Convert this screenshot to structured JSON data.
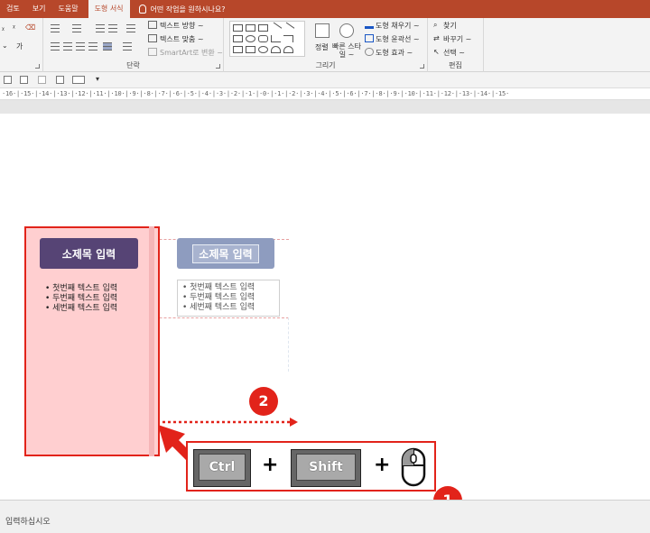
{
  "tabs": [
    "검토",
    "보기",
    "도움말",
    "도형 서식"
  ],
  "active_tab": "도형 서식",
  "tell_me": "어떤 작업을 원하시나요?",
  "ribbon": {
    "paragraph": {
      "label": "단락",
      "text_direction": "텍스트 방향 ~",
      "align_text": "텍스트 맞춤 ~",
      "smartart": "SmartArt로 변환 ~"
    },
    "drawing": {
      "label": "그리기",
      "arrange": "정렬",
      "quick_styles": "빠른 스타일 ~",
      "shape_fill": "도형 채우기 ~",
      "shape_outline": "도형 윤곽선 ~",
      "shape_effects": "도형 효과 ~"
    },
    "editing": {
      "label": "편집",
      "find": "찾기",
      "replace": "바꾸기 ~",
      "select": "선택 ~"
    }
  },
  "ruler": "·16·|·15·|·14·|·13·|·12·|·11·|·10·|·9·|·8·|·7·|·6·|·5·|·4·|·3·|·2·|·1·|·0·|·1·|·2·|·3·|·4·|·5·|·6·|·7·|·8·|·9·|·10·|·11·|·12·|·13·|·14·|·15·",
  "slide": {
    "card_title": "소제목 입력",
    "bullets": [
      "• 첫번째 텍스트 입력",
      "• 두번째 텍스트 입력",
      "• 세번째 텍스트 입력"
    ],
    "badge_1": "1",
    "badge_2": "2",
    "keys": {
      "ctrl": "Ctrl",
      "shift": "Shift",
      "plus": "+"
    }
  },
  "status": "입력하십시오",
  "colors": {
    "accent": "#b7472a",
    "highlight": "#e2231a",
    "title_fill": "#564475",
    "ghost_fill": "#8e9cbf"
  }
}
